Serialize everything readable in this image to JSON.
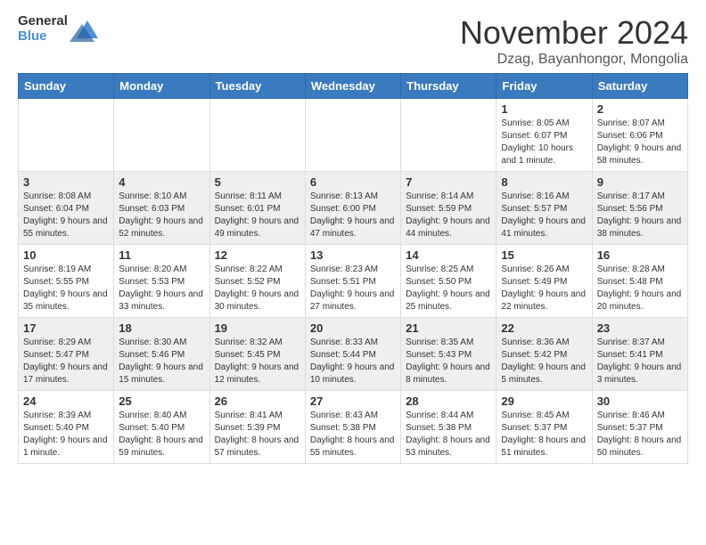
{
  "logo": {
    "general": "General",
    "blue": "Blue"
  },
  "header": {
    "month_year": "November 2024",
    "location": "Dzag, Bayanhongor, Mongolia"
  },
  "weekdays": [
    "Sunday",
    "Monday",
    "Tuesday",
    "Wednesday",
    "Thursday",
    "Friday",
    "Saturday"
  ],
  "weeks": [
    [
      {
        "day": "",
        "info": ""
      },
      {
        "day": "",
        "info": ""
      },
      {
        "day": "",
        "info": ""
      },
      {
        "day": "",
        "info": ""
      },
      {
        "day": "",
        "info": ""
      },
      {
        "day": "1",
        "info": "Sunrise: 8:05 AM\nSunset: 6:07 PM\nDaylight: 10 hours and 1 minute."
      },
      {
        "day": "2",
        "info": "Sunrise: 8:07 AM\nSunset: 6:06 PM\nDaylight: 9 hours and 58 minutes."
      }
    ],
    [
      {
        "day": "3",
        "info": "Sunrise: 8:08 AM\nSunset: 6:04 PM\nDaylight: 9 hours and 55 minutes."
      },
      {
        "day": "4",
        "info": "Sunrise: 8:10 AM\nSunset: 6:03 PM\nDaylight: 9 hours and 52 minutes."
      },
      {
        "day": "5",
        "info": "Sunrise: 8:11 AM\nSunset: 6:01 PM\nDaylight: 9 hours and 49 minutes."
      },
      {
        "day": "6",
        "info": "Sunrise: 8:13 AM\nSunset: 6:00 PM\nDaylight: 9 hours and 47 minutes."
      },
      {
        "day": "7",
        "info": "Sunrise: 8:14 AM\nSunset: 5:59 PM\nDaylight: 9 hours and 44 minutes."
      },
      {
        "day": "8",
        "info": "Sunrise: 8:16 AM\nSunset: 5:57 PM\nDaylight: 9 hours and 41 minutes."
      },
      {
        "day": "9",
        "info": "Sunrise: 8:17 AM\nSunset: 5:56 PM\nDaylight: 9 hours and 38 minutes."
      }
    ],
    [
      {
        "day": "10",
        "info": "Sunrise: 8:19 AM\nSunset: 5:55 PM\nDaylight: 9 hours and 35 minutes."
      },
      {
        "day": "11",
        "info": "Sunrise: 8:20 AM\nSunset: 5:53 PM\nDaylight: 9 hours and 33 minutes."
      },
      {
        "day": "12",
        "info": "Sunrise: 8:22 AM\nSunset: 5:52 PM\nDaylight: 9 hours and 30 minutes."
      },
      {
        "day": "13",
        "info": "Sunrise: 8:23 AM\nSunset: 5:51 PM\nDaylight: 9 hours and 27 minutes."
      },
      {
        "day": "14",
        "info": "Sunrise: 8:25 AM\nSunset: 5:50 PM\nDaylight: 9 hours and 25 minutes."
      },
      {
        "day": "15",
        "info": "Sunrise: 8:26 AM\nSunset: 5:49 PM\nDaylight: 9 hours and 22 minutes."
      },
      {
        "day": "16",
        "info": "Sunrise: 8:28 AM\nSunset: 5:48 PM\nDaylight: 9 hours and 20 minutes."
      }
    ],
    [
      {
        "day": "17",
        "info": "Sunrise: 8:29 AM\nSunset: 5:47 PM\nDaylight: 9 hours and 17 minutes."
      },
      {
        "day": "18",
        "info": "Sunrise: 8:30 AM\nSunset: 5:46 PM\nDaylight: 9 hours and 15 minutes."
      },
      {
        "day": "19",
        "info": "Sunrise: 8:32 AM\nSunset: 5:45 PM\nDaylight: 9 hours and 12 minutes."
      },
      {
        "day": "20",
        "info": "Sunrise: 8:33 AM\nSunset: 5:44 PM\nDaylight: 9 hours and 10 minutes."
      },
      {
        "day": "21",
        "info": "Sunrise: 8:35 AM\nSunset: 5:43 PM\nDaylight: 9 hours and 8 minutes."
      },
      {
        "day": "22",
        "info": "Sunrise: 8:36 AM\nSunset: 5:42 PM\nDaylight: 9 hours and 5 minutes."
      },
      {
        "day": "23",
        "info": "Sunrise: 8:37 AM\nSunset: 5:41 PM\nDaylight: 9 hours and 3 minutes."
      }
    ],
    [
      {
        "day": "24",
        "info": "Sunrise: 8:39 AM\nSunset: 5:40 PM\nDaylight: 9 hours and 1 minute."
      },
      {
        "day": "25",
        "info": "Sunrise: 8:40 AM\nSunset: 5:40 PM\nDaylight: 8 hours and 59 minutes."
      },
      {
        "day": "26",
        "info": "Sunrise: 8:41 AM\nSunset: 5:39 PM\nDaylight: 8 hours and 57 minutes."
      },
      {
        "day": "27",
        "info": "Sunrise: 8:43 AM\nSunset: 5:38 PM\nDaylight: 8 hours and 55 minutes."
      },
      {
        "day": "28",
        "info": "Sunrise: 8:44 AM\nSunset: 5:38 PM\nDaylight: 8 hours and 53 minutes."
      },
      {
        "day": "29",
        "info": "Sunrise: 8:45 AM\nSunset: 5:37 PM\nDaylight: 8 hours and 51 minutes."
      },
      {
        "day": "30",
        "info": "Sunrise: 8:46 AM\nSunset: 5:37 PM\nDaylight: 8 hours and 50 minutes."
      }
    ]
  ]
}
